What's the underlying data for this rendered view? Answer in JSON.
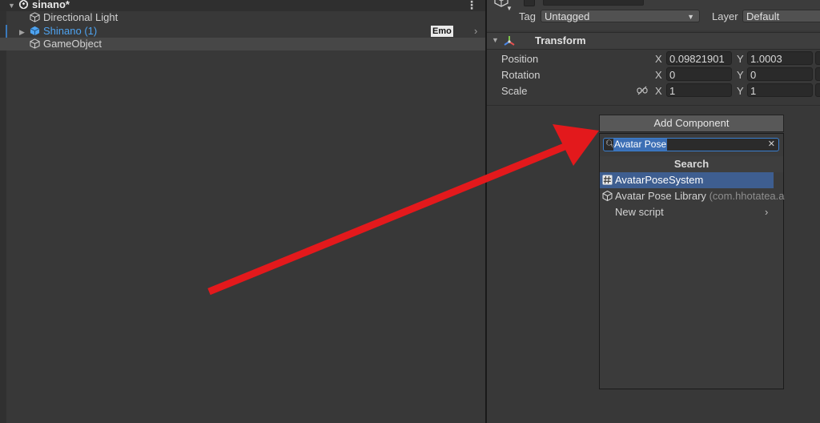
{
  "hierarchy": {
    "scene_name": "sinano*",
    "items": [
      {
        "name": "Directional Light"
      },
      {
        "name": "Shinano (1)",
        "badge": "Emo"
      },
      {
        "name": "GameObject"
      }
    ]
  },
  "inspector": {
    "tag_label": "Tag",
    "tag_value": "Untagged",
    "layer_label": "Layer",
    "layer_value": "Default",
    "component_title": "Transform",
    "position": {
      "label": "Position",
      "x_axis": "X",
      "x": "0.09821901",
      "y_axis": "Y",
      "y": "1.0003"
    },
    "rotation": {
      "label": "Rotation",
      "x_axis": "X",
      "x": "0",
      "y_axis": "Y",
      "y": "0"
    },
    "scale": {
      "label": "Scale",
      "x_axis": "X",
      "x": "1",
      "y_axis": "Y",
      "y": "1"
    }
  },
  "add_component": {
    "button_label": "Add Component",
    "search_value": "Avatar Pose",
    "popup_title": "Search",
    "results": [
      {
        "label": "AvatarPoseSystem",
        "icon": "script-hash-icon"
      },
      {
        "label": "Avatar Pose Library",
        "sub": "(com.hhotatea.a",
        "icon": "package-icon"
      },
      {
        "label": "New script",
        "icon": ""
      }
    ]
  },
  "colors": {
    "accent_blue": "#3e5e90",
    "selected_text": "#4ea3f0",
    "annotation_arrow": "#e3191c"
  }
}
